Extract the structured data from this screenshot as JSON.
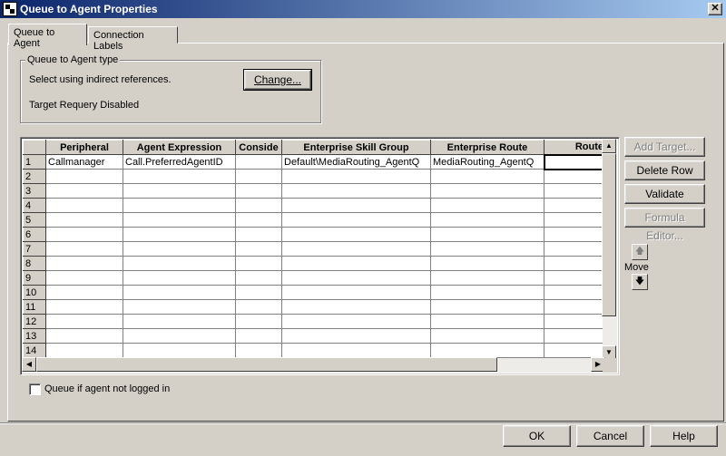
{
  "window": {
    "title": "Queue to Agent Properties",
    "close_glyph": "✕"
  },
  "tabs": [
    {
      "label": "Queue to Agent",
      "active": true
    },
    {
      "label": "Connection Labels",
      "active": false
    }
  ],
  "type_group": {
    "legend": "Queue to Agent type",
    "select_text": "Select using indirect references.",
    "requery_text": "Target Requery Disabled",
    "change_button": "Change..."
  },
  "grid": {
    "columns": [
      "Peripheral",
      "Agent Expression",
      "Conside",
      "Enterprise Skill Group",
      "Enterprise Route",
      "Route"
    ],
    "rows": [
      [
        "1",
        "Callmanager",
        "Call.PreferredAgentID",
        "",
        "Default\\MediaRouting_AgentQ",
        "MediaRouting_AgentQ",
        ""
      ],
      [
        "2",
        "",
        "",
        "",
        "",
        "",
        ""
      ],
      [
        "3",
        "",
        "",
        "",
        "",
        "",
        ""
      ],
      [
        "4",
        "",
        "",
        "",
        "",
        "",
        ""
      ],
      [
        "5",
        "",
        "",
        "",
        "",
        "",
        ""
      ],
      [
        "6",
        "",
        "",
        "",
        "",
        "",
        ""
      ],
      [
        "7",
        "",
        "",
        "",
        "",
        "",
        ""
      ],
      [
        "8",
        "",
        "",
        "",
        "",
        "",
        ""
      ],
      [
        "9",
        "",
        "",
        "",
        "",
        "",
        ""
      ],
      [
        "10",
        "",
        "",
        "",
        "",
        "",
        ""
      ],
      [
        "11",
        "",
        "",
        "",
        "",
        "",
        ""
      ],
      [
        "12",
        "",
        "",
        "",
        "",
        "",
        ""
      ],
      [
        "13",
        "",
        "",
        "",
        "",
        "",
        ""
      ],
      [
        "14",
        "",
        "",
        "",
        "",
        "",
        ""
      ]
    ]
  },
  "side_buttons": {
    "add_target": "Add Target...",
    "delete_row": "Delete Row",
    "validate": "Validate",
    "formula_editor": "Formula Editor...",
    "move_label": "Move"
  },
  "checkbox": {
    "label": "Queue if agent not logged in",
    "checked": false
  },
  "footer": {
    "ok": "OK",
    "cancel": "Cancel",
    "help": "Help"
  },
  "icons": {
    "scroll_up": "▲",
    "scroll_down": "▼",
    "scroll_left": "◀",
    "scroll_right": "▶",
    "move_up": "🡅",
    "move_down": "🡇"
  }
}
